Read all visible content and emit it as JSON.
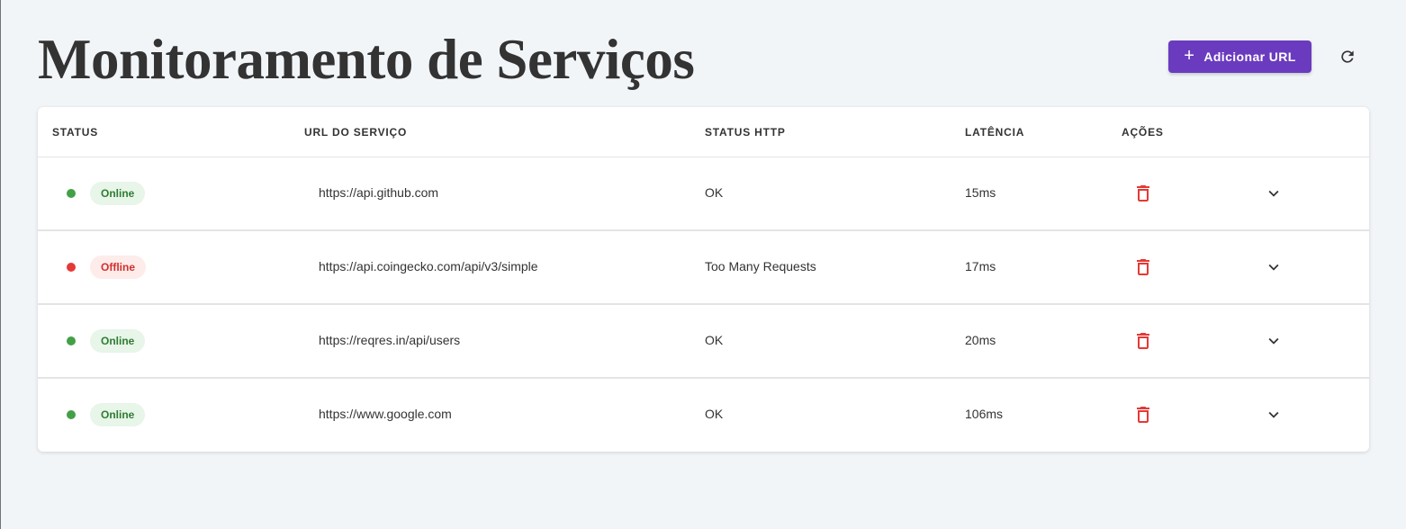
{
  "header": {
    "title": "Monitoramento de Serviços",
    "add_button_label": "Adicionar URL",
    "add_icon": "plus-icon",
    "refresh_icon": "refresh-icon"
  },
  "table": {
    "columns": [
      "STATUS",
      "URL DO SERVIÇO",
      "STATUS HTTP",
      "LATÊNCIA",
      "AÇÕES"
    ],
    "rows": [
      {
        "status": "Online",
        "url": "https://api.github.com",
        "http_status": "OK",
        "latency": "15ms"
      },
      {
        "status": "Offline",
        "url": "https://api.coingecko.com/api/v3/simple",
        "http_status": "Too Many Requests",
        "latency": "17ms"
      },
      {
        "status": "Online",
        "url": "https://reqres.in/api/users",
        "http_status": "OK",
        "latency": "20ms"
      },
      {
        "status": "Online",
        "url": "https://www.google.com",
        "http_status": "OK",
        "latency": "106ms"
      }
    ],
    "delete_icon": "trash-icon",
    "expand_icon": "chevron-down-icon"
  },
  "colors": {
    "page_background": "#f2f5f8",
    "accent": "#6a3bbf",
    "online_dot": "#43a047",
    "online_badge_bg": "#e8f5e9",
    "online_badge_text": "#2e7d32",
    "offline_dot": "#e53935",
    "offline_badge_bg": "#fdecea",
    "offline_badge_text": "#d32f2f",
    "delete_icon": "#e53935"
  }
}
